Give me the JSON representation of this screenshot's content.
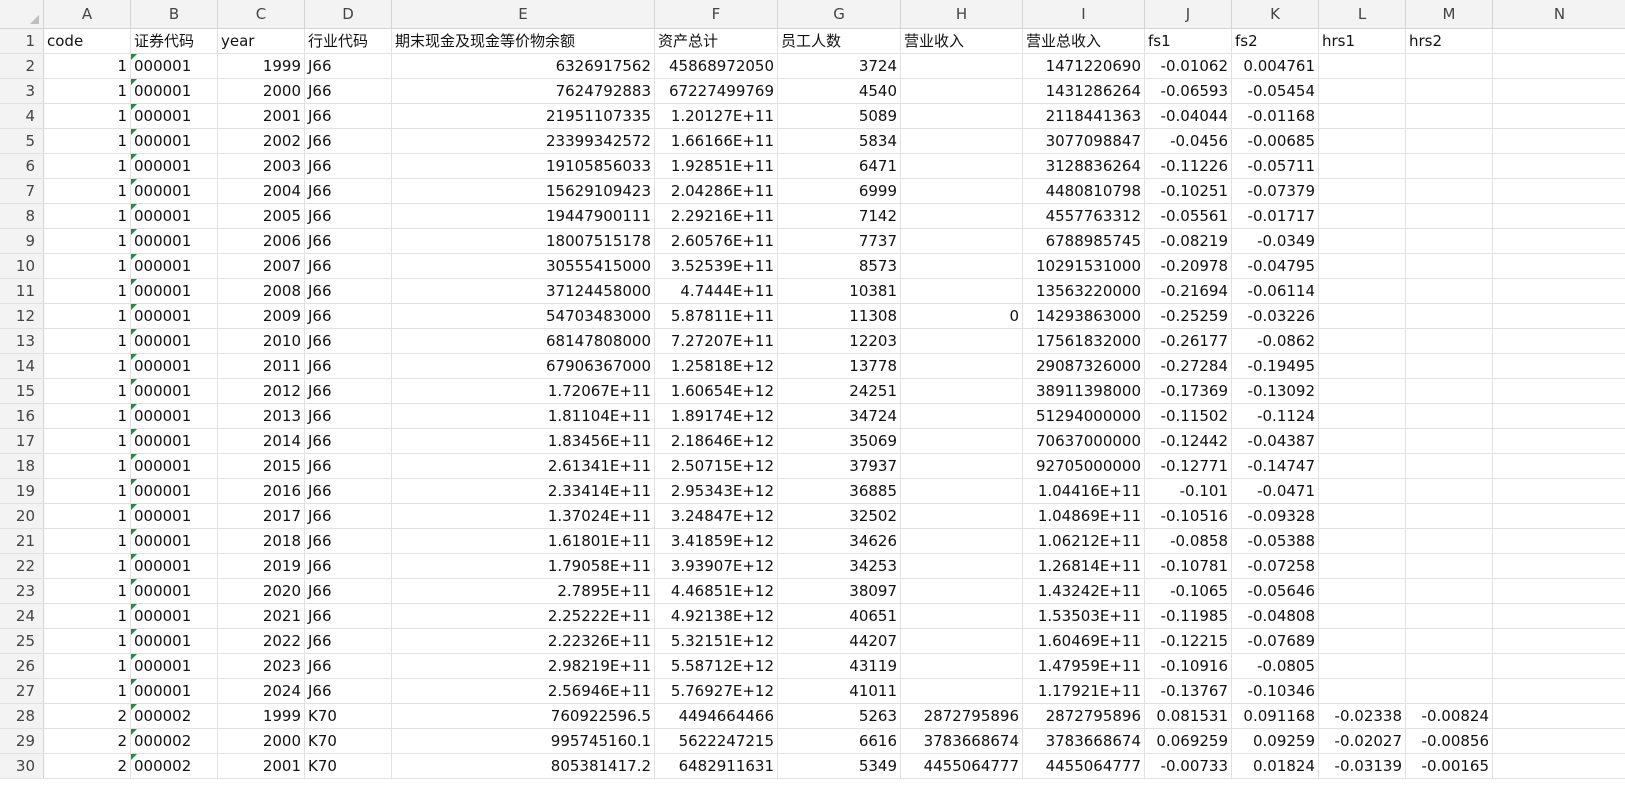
{
  "columns": [
    "A",
    "B",
    "C",
    "D",
    "E",
    "F",
    "G",
    "H",
    "I",
    "J",
    "K",
    "L",
    "M",
    "N"
  ],
  "rows": [
    {
      "n": "1",
      "c": [
        "code",
        "证券代码",
        "year",
        "行业代码",
        "期末现金及现金等价物余额",
        "资产总计",
        "员工人数",
        "营业收入",
        "营业总收入",
        "fs1",
        "fs2",
        "hrs1",
        "hrs2",
        ""
      ]
    },
    {
      "n": "2",
      "c": [
        "1",
        "000001",
        "1999",
        "J66",
        "6326917562",
        "45868972050",
        "3724",
        "",
        "1471220690",
        "-0.01062",
        "0.004761",
        "",
        "",
        " "
      ]
    },
    {
      "n": "3",
      "c": [
        "1",
        "000001",
        "2000",
        "J66",
        "7624792883",
        "67227499769",
        "4540",
        "",
        "1431286264",
        "-0.06593",
        "-0.05454",
        "",
        "",
        " "
      ]
    },
    {
      "n": "4",
      "c": [
        "1",
        "000001",
        "2001",
        "J66",
        "21951107335",
        "1.20127E+11",
        "5089",
        "",
        "2118441363",
        "-0.04044",
        "-0.01168",
        "",
        "",
        " "
      ]
    },
    {
      "n": "5",
      "c": [
        "1",
        "000001",
        "2002",
        "J66",
        "23399342572",
        "1.66166E+11",
        "5834",
        "",
        "3077098847",
        "-0.0456",
        "-0.00685",
        "",
        "",
        " "
      ]
    },
    {
      "n": "6",
      "c": [
        "1",
        "000001",
        "2003",
        "J66",
        "19105856033",
        "1.92851E+11",
        "6471",
        "",
        "3128836264",
        "-0.11226",
        "-0.05711",
        "",
        "",
        " "
      ]
    },
    {
      "n": "7",
      "c": [
        "1",
        "000001",
        "2004",
        "J66",
        "15629109423",
        "2.04286E+11",
        "6999",
        "",
        "4480810798",
        "-0.10251",
        "-0.07379",
        "",
        "",
        " "
      ]
    },
    {
      "n": "8",
      "c": [
        "1",
        "000001",
        "2005",
        "J66",
        "19447900111",
        "2.29216E+11",
        "7142",
        "",
        "4557763312",
        "-0.05561",
        "-0.01717",
        "",
        "",
        " "
      ]
    },
    {
      "n": "9",
      "c": [
        "1",
        "000001",
        "2006",
        "J66",
        "18007515178",
        "2.60576E+11",
        "7737",
        "",
        "6788985745",
        "-0.08219",
        "-0.0349",
        "",
        "",
        " "
      ]
    },
    {
      "n": "10",
      "c": [
        "1",
        "000001",
        "2007",
        "J66",
        "30555415000",
        "3.52539E+11",
        "8573",
        "",
        "10291531000",
        "-0.20978",
        "-0.04795",
        "",
        "",
        " "
      ]
    },
    {
      "n": "11",
      "c": [
        "1",
        "000001",
        "2008",
        "J66",
        "37124458000",
        "4.7444E+11",
        "10381",
        "",
        "13563220000",
        "-0.21694",
        "-0.06114",
        "",
        "",
        " "
      ]
    },
    {
      "n": "12",
      "c": [
        "1",
        "000001",
        "2009",
        "J66",
        "54703483000",
        "5.87811E+11",
        "11308",
        "0",
        "14293863000",
        "-0.25259",
        "-0.03226",
        "",
        "",
        " "
      ]
    },
    {
      "n": "13",
      "c": [
        "1",
        "000001",
        "2010",
        "J66",
        "68147808000",
        "7.27207E+11",
        "12203",
        "",
        "17561832000",
        "-0.26177",
        "-0.0862",
        "",
        "",
        " "
      ]
    },
    {
      "n": "14",
      "c": [
        "1",
        "000001",
        "2011",
        "J66",
        "67906367000",
        "1.25818E+12",
        "13778",
        "",
        "29087326000",
        "-0.27284",
        "-0.19495",
        "",
        "",
        " "
      ]
    },
    {
      "n": "15",
      "c": [
        "1",
        "000001",
        "2012",
        "J66",
        "1.72067E+11",
        "1.60654E+12",
        "24251",
        "",
        "38911398000",
        "-0.17369",
        "-0.13092",
        "",
        "",
        " "
      ]
    },
    {
      "n": "16",
      "c": [
        "1",
        "000001",
        "2013",
        "J66",
        "1.81104E+11",
        "1.89174E+12",
        "34724",
        "",
        "51294000000",
        "-0.11502",
        "-0.1124",
        "",
        "",
        " "
      ]
    },
    {
      "n": "17",
      "c": [
        "1",
        "000001",
        "2014",
        "J66",
        "1.83456E+11",
        "2.18646E+12",
        "35069",
        "",
        "70637000000",
        "-0.12442",
        "-0.04387",
        "",
        "",
        " "
      ]
    },
    {
      "n": "18",
      "c": [
        "1",
        "000001",
        "2015",
        "J66",
        "2.61341E+11",
        "2.50715E+12",
        "37937",
        "",
        "92705000000",
        "-0.12771",
        "-0.14747",
        "",
        "",
        " "
      ]
    },
    {
      "n": "19",
      "c": [
        "1",
        "000001",
        "2016",
        "J66",
        "2.33414E+11",
        "2.95343E+12",
        "36885",
        "",
        "1.04416E+11",
        "-0.101",
        "-0.0471",
        "",
        "",
        " "
      ]
    },
    {
      "n": "20",
      "c": [
        "1",
        "000001",
        "2017",
        "J66",
        "1.37024E+11",
        "3.24847E+12",
        "32502",
        "",
        "1.04869E+11",
        "-0.10516",
        "-0.09328",
        "",
        "",
        " "
      ]
    },
    {
      "n": "21",
      "c": [
        "1",
        "000001",
        "2018",
        "J66",
        "1.61801E+11",
        "3.41859E+12",
        "34626",
        "",
        "1.06212E+11",
        "-0.0858",
        "-0.05388",
        "",
        "",
        " "
      ]
    },
    {
      "n": "22",
      "c": [
        "1",
        "000001",
        "2019",
        "J66",
        "1.79058E+11",
        "3.93907E+12",
        "34253",
        "",
        "1.26814E+11",
        "-0.10781",
        "-0.07258",
        "",
        "",
        " "
      ]
    },
    {
      "n": "23",
      "c": [
        "1",
        "000001",
        "2020",
        "J66",
        "2.7895E+11",
        "4.46851E+12",
        "38097",
        "",
        "1.43242E+11",
        "-0.1065",
        "-0.05646",
        "",
        "",
        " "
      ]
    },
    {
      "n": "24",
      "c": [
        "1",
        "000001",
        "2021",
        "J66",
        "2.25222E+11",
        "4.92138E+12",
        "40651",
        "",
        "1.53503E+11",
        "-0.11985",
        "-0.04808",
        "",
        "",
        " "
      ]
    },
    {
      "n": "25",
      "c": [
        "1",
        "000001",
        "2022",
        "J66",
        "2.22326E+11",
        "5.32151E+12",
        "44207",
        "",
        "1.60469E+11",
        "-0.12215",
        "-0.07689",
        "",
        "",
        " "
      ]
    },
    {
      "n": "26",
      "c": [
        "1",
        "000001",
        "2023",
        "J66",
        "2.98219E+11",
        "5.58712E+12",
        "43119",
        "",
        "1.47959E+11",
        "-0.10916",
        "-0.0805",
        "",
        "",
        " "
      ]
    },
    {
      "n": "27",
      "c": [
        "1",
        "000001",
        "2024",
        "J66",
        "2.56946E+11",
        "5.76927E+12",
        "41011",
        "",
        "1.17921E+11",
        "-0.13767",
        "-0.10346",
        "",
        "",
        " "
      ]
    },
    {
      "n": "28",
      "c": [
        "2",
        "000002",
        "1999",
        "K70",
        "760922596.5",
        "4494664466",
        "5263",
        "2872795896",
        "2872795896",
        "0.081531",
        "0.091168",
        "-0.02338",
        "-0.00824",
        " "
      ]
    },
    {
      "n": "29",
      "c": [
        "2",
        "000002",
        "2000",
        "K70",
        "995745160.1",
        "5622247215",
        "6616",
        "3783668674",
        "3783668674",
        "0.069259",
        "0.09259",
        "-0.02027",
        "-0.00856",
        " "
      ]
    },
    {
      "n": "30",
      "c": [
        "2",
        "000002",
        "2001",
        "K70",
        "805381417.2",
        "6482911631",
        "5349",
        "4455064777",
        "4455064777",
        "-0.00733",
        "0.01824",
        "-0.03139",
        "-0.00165",
        " "
      ]
    }
  ]
}
